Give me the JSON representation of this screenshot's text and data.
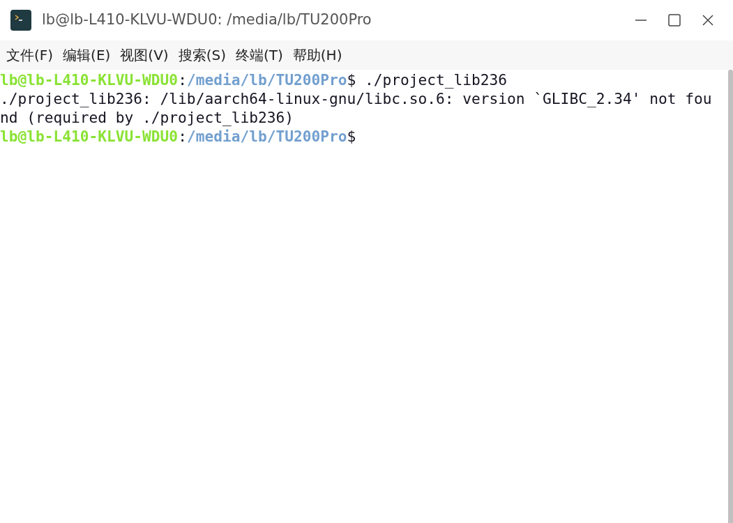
{
  "window": {
    "title": "lb@lb-L410-KLVU-WDU0: /media/lb/TU200Pro"
  },
  "menu": [
    "文件(F)",
    "编辑(E)",
    "视图(V)",
    "搜索(S)",
    "终端(T)",
    "帮助(H)"
  ],
  "terminal": {
    "lines": [
      {
        "segments": [
          {
            "kind": "user",
            "text": "lb@lb-L410-KLVU-WDU0"
          },
          {
            "kind": "plain",
            "text": ":"
          },
          {
            "kind": "path",
            "text": "/media/lb/TU200Pro"
          },
          {
            "kind": "plain",
            "text": "$ ./project_lib236"
          }
        ]
      },
      {
        "segments": [
          {
            "kind": "plain",
            "text": "./project_lib236: /lib/aarch64-linux-gnu/libc.so.6: version `GLIBC_2.34' not fou"
          }
        ]
      },
      {
        "segments": [
          {
            "kind": "plain",
            "text": "nd (required by ./project_lib236)"
          }
        ]
      },
      {
        "segments": [
          {
            "kind": "user",
            "text": "lb@lb-L410-KLVU-WDU0"
          },
          {
            "kind": "plain",
            "text": ":"
          },
          {
            "kind": "path",
            "text": "/media/lb/TU200Pro"
          },
          {
            "kind": "plain",
            "text": "$"
          }
        ]
      }
    ]
  }
}
